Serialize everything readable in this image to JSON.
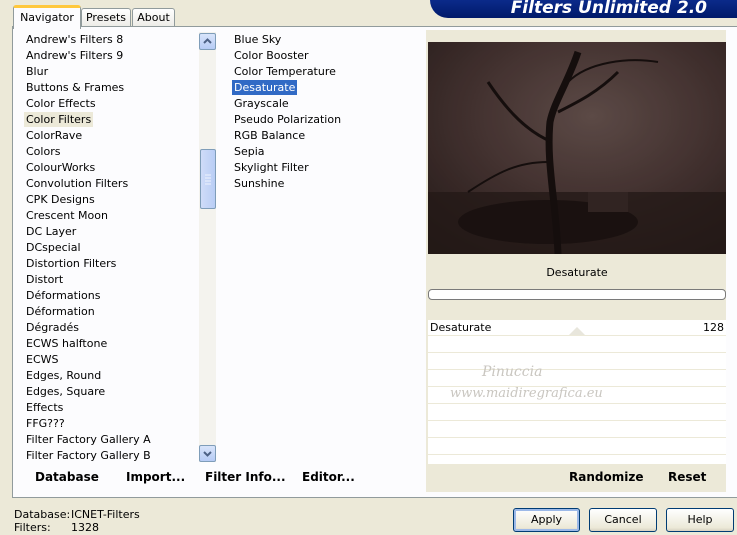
{
  "banner": "Filters Unlimited 2.0",
  "tabs": [
    {
      "label": "Navigator",
      "active": true
    },
    {
      "label": "Presets",
      "active": false
    },
    {
      "label": "About",
      "active": false
    }
  ],
  "categories": [
    "Andrew's Filters 8",
    "Andrew's Filters 9",
    "Blur",
    "Buttons & Frames",
    "Color Effects",
    "Color Filters",
    "ColorRave",
    "Colors",
    "ColourWorks",
    "Convolution Filters",
    "CPK Designs",
    "Crescent Moon",
    "DC Layer",
    "DCspecial",
    "Distortion Filters",
    "Distort",
    "Déformations",
    "Déformation",
    "Dégradés",
    "ECWS halftone",
    "ECWS",
    "Edges, Round",
    "Edges, Square",
    "Effects",
    "FFG???",
    "Filter Factory Gallery A",
    "Filter Factory Gallery B"
  ],
  "selected_category": "Color Filters",
  "filters": [
    "Blue Sky",
    "Color Booster",
    "Color Temperature",
    "Desaturate",
    "Grayscale",
    "Pseudo Polarization",
    "RGB Balance",
    "Sepia",
    "Skylight Filter",
    "Sunshine"
  ],
  "selected_filter": "Desaturate",
  "preview": {
    "filter_name": "Desaturate",
    "progress": 0
  },
  "parameter": {
    "name": "Desaturate",
    "value": "128"
  },
  "watermark": {
    "line1": "Pinuccia",
    "line2": "www.maidiregrafica.eu"
  },
  "toolbar": {
    "database": "Database",
    "import": "Import...",
    "filter_info": "Filter Info...",
    "editor": "Editor...",
    "randomize": "Randomize",
    "reset": "Reset"
  },
  "status": {
    "database_label": "Database:",
    "database_value": "ICNET-Filters",
    "filters_label": "Filters:",
    "filters_value": "1328"
  },
  "buttons": {
    "apply": "Apply",
    "cancel": "Cancel",
    "help": "Help"
  },
  "colors": {
    "selection": "#316ac5",
    "banner": "#0b2a8a",
    "face": "#ece9d8"
  }
}
